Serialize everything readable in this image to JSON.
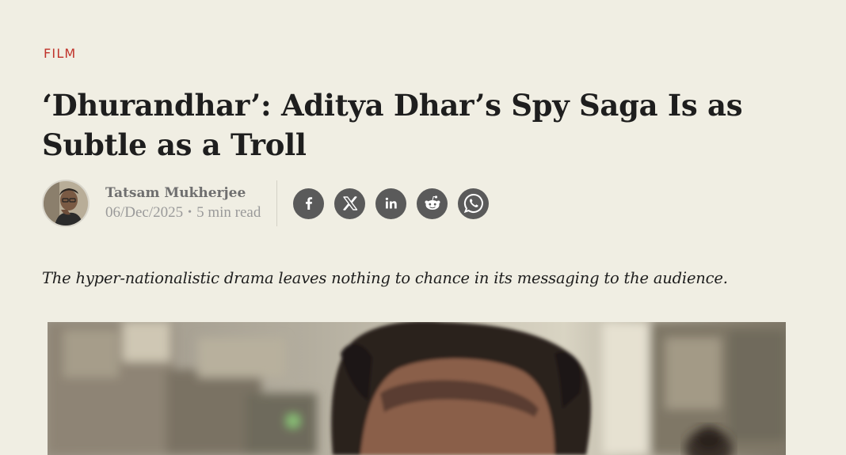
{
  "article": {
    "category": "FILM",
    "title": "‘Dhurandhar’: Aditya Dhar’s Spy Saga Is as Subtle as a Troll",
    "author": "Tatsam Mukherjee",
    "date": "06/Dec/2025",
    "separator": "•",
    "read_time": "5 min read",
    "dek": "The hyper-nationalistic drama leaves nothing to chance in its messaging to the audience."
  },
  "share": {
    "buttons": [
      {
        "name": "facebook",
        "icon": "facebook-icon"
      },
      {
        "name": "x",
        "icon": "x-twitter-icon"
      },
      {
        "name": "linkedin",
        "icon": "linkedin-icon"
      },
      {
        "name": "reddit",
        "icon": "reddit-icon"
      },
      {
        "name": "whatsapp",
        "icon": "whatsapp-icon"
      }
    ]
  },
  "colors": {
    "background": "#f0eee3",
    "category": "#c0332b",
    "share_button": "#5a5a5a",
    "meta_text": "#9a9a9a"
  }
}
